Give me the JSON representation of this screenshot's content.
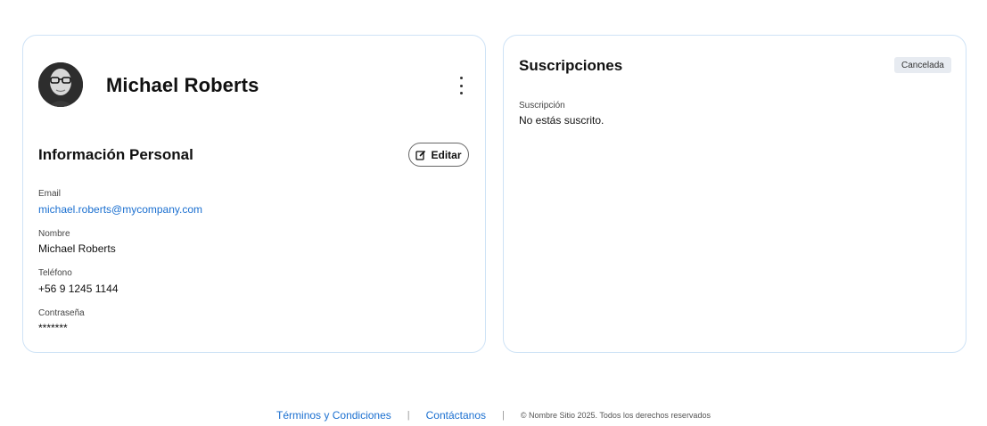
{
  "profile": {
    "name": "Michael Roberts",
    "more_icon": "more-vertical-icon"
  },
  "personal_info": {
    "title": "Información Personal",
    "edit_label": "Editar",
    "edit_icon": "edit-icon",
    "fields": [
      {
        "label": "Email",
        "value": "michael.roberts@mycompany.com"
      },
      {
        "label": "Nombre",
        "value": "Michael Roberts"
      },
      {
        "label": "Teléfono",
        "value": "+56 9 1245 1144"
      },
      {
        "label": "Contraseña",
        "value": "*******"
      }
    ]
  },
  "subscriptions": {
    "title": "Suscripciones",
    "status": "Cancelada",
    "label": "Suscripción",
    "value": "No estás suscrito."
  },
  "footer": {
    "terms": "Términos y Condiciones",
    "separator": "|",
    "contact": "Contáctanos",
    "copyright": "© Nombre Sitio 2025. Todos los derechos reservados"
  },
  "colors": {
    "link": "#1a6fd0",
    "card_border": "#cfe3f6",
    "badge_bg": "#e7ebf1"
  }
}
